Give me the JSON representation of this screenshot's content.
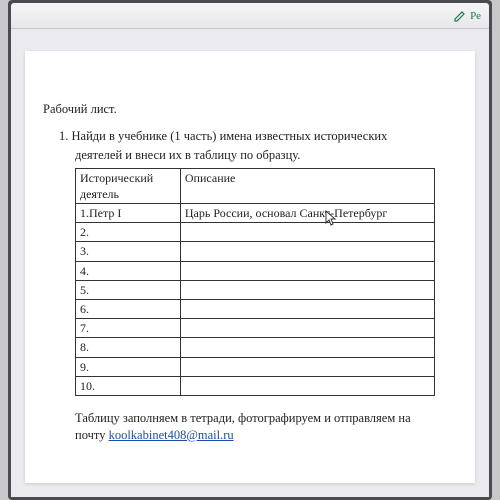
{
  "toolbar": {
    "action_label": "Ре"
  },
  "document": {
    "title": "Рабочий лист.",
    "task_number": "1.",
    "task_line1": "Найди в учебнике (1 часть) имена известных исторических",
    "task_line2": "деятелей и внеси их в таблицу по образцу.",
    "table": {
      "header_col1_line1": "Исторический",
      "header_col1_line2": "деятель",
      "header_col2": "Описание",
      "rows": [
        {
          "num": "1.",
          "figure": "Петр I",
          "desc": "Царь России, основал Санкт-Петербург"
        },
        {
          "num": "2.",
          "figure": "",
          "desc": ""
        },
        {
          "num": "3.",
          "figure": "",
          "desc": ""
        },
        {
          "num": "4.",
          "figure": "",
          "desc": ""
        },
        {
          "num": "5.",
          "figure": "",
          "desc": ""
        },
        {
          "num": "6.",
          "figure": "",
          "desc": ""
        },
        {
          "num": "7.",
          "figure": "",
          "desc": ""
        },
        {
          "num": "8.",
          "figure": "",
          "desc": ""
        },
        {
          "num": "9.",
          "figure": "",
          "desc": ""
        },
        {
          "num": "10.",
          "figure": "",
          "desc": ""
        }
      ]
    },
    "footer_line1": "Таблицу заполняем в  тетради, фотографируем и отправляем на",
    "footer_line2_prefix": "почту ",
    "footer_email": "koolkabinet408@mail.ru"
  }
}
